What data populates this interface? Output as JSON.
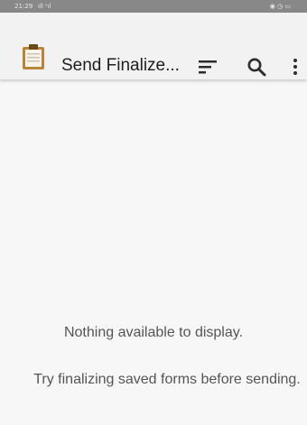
{
  "status_bar": {
    "time": "21:29",
    "signal_text": "ıll ᶻıl",
    "right_icons_text": "◉ ◷ ▭"
  },
  "toolbar": {
    "title": "Send Finalize...",
    "icons": [
      "clipboard-icon",
      "sort-icon",
      "search-icon",
      "more-vert-icon"
    ]
  },
  "empty_state": {
    "title": "Nothing available to display.",
    "hint": "Try finalizing saved forms before sending."
  },
  "colors": {
    "status_bar": "#888888",
    "toolbar": "#f2f2f2",
    "background": "#f7f7f7",
    "clipboard_body": "#b8863a",
    "clipboard_clip": "#6b4a16",
    "text": "#555555"
  }
}
